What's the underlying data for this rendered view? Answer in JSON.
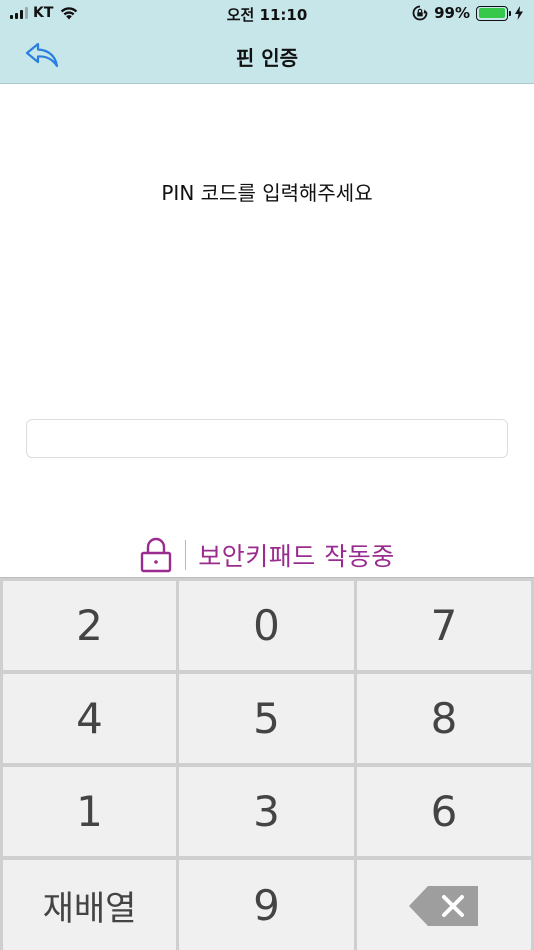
{
  "status_bar": {
    "carrier": "KT",
    "time": "오전 11:10",
    "battery_percent": "99%",
    "battery_level": 0.99,
    "icons": [
      "signal-icon",
      "wifi-icon",
      "orientation-lock-icon",
      "battery-icon",
      "charging-icon"
    ]
  },
  "nav": {
    "title": "핀 인증",
    "back_icon": "back-arrow-icon"
  },
  "content": {
    "prompt": "PIN 코드를 입력해주세요",
    "pin_value": ""
  },
  "secure_keypad": {
    "label": "보안키패드 작동중",
    "icon": "padlock-icon"
  },
  "keypad": {
    "rows": [
      [
        "2",
        "0",
        "7"
      ],
      [
        "4",
        "5",
        "8"
      ],
      [
        "1",
        "3",
        "6"
      ],
      [
        "재배열",
        "9",
        ""
      ]
    ],
    "shuffle_label": "재배열",
    "backspace_icon": "backspace-icon"
  },
  "colors": {
    "header_bg": "#c6e6ea",
    "accent_back": "#2a7fe0",
    "secure_text": "#9b2c8f",
    "battery": "#35c84a"
  }
}
